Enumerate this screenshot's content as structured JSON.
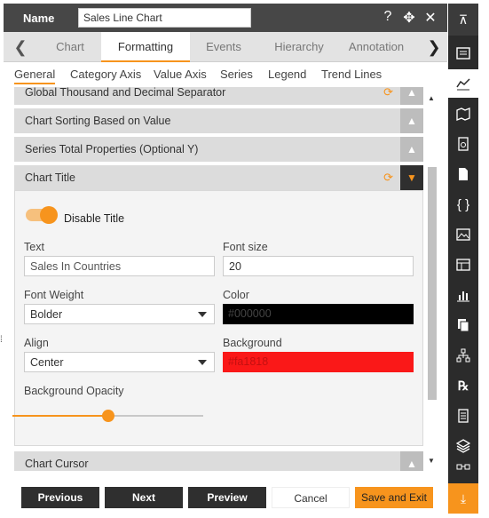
{
  "header": {
    "name_label": "Name",
    "name_value": "Sales Line Chart",
    "icons": [
      "help-icon",
      "move-icon",
      "close-icon"
    ]
  },
  "tabs": {
    "items": [
      "Chart",
      "Formatting",
      "Events",
      "Hierarchy",
      "Annotation"
    ],
    "active": "Formatting"
  },
  "subtabs": {
    "items": [
      "General",
      "Category Axis",
      "Value Axis",
      "Series",
      "Legend",
      "Trend Lines"
    ],
    "active": "General"
  },
  "sections": {
    "thousand": "Global Thousand and Decimal Separator",
    "sorting": "Chart Sorting Based on Value",
    "series_total": "Series Total Properties (Optional Y)",
    "chart_title": "Chart Title",
    "chart_cursor": "Chart Cursor"
  },
  "chart_title_panel": {
    "toggle_label": "Disable Title",
    "toggle_on": true,
    "text_label": "Text",
    "text_value": "Sales In Countries",
    "font_size_label": "Font size",
    "font_size_value": "20",
    "font_weight_label": "Font Weight",
    "font_weight_value": "Bolder",
    "color_label": "Color",
    "color_value": "#000000",
    "align_label": "Align",
    "align_value": "Center",
    "background_label": "Background",
    "background_value": "#fa1818",
    "opacity_label": "Background Opacity",
    "opacity_level": 0.5
  },
  "colors": {
    "accent": "#f7941d",
    "header_bg": "#474747",
    "section_bg": "#dcdcdc",
    "rail_bg": "#2b2b2b",
    "color_swatch": "#000000",
    "background_swatch": "#fa1818"
  },
  "footer": {
    "previous": "Previous",
    "next": "Next",
    "preview": "Preview",
    "cancel": "Cancel",
    "save_exit": "Save and Exit"
  },
  "rail": {
    "icons": [
      "collapse-up-icon",
      "chart-list-icon",
      "line-chart-icon",
      "map-icon",
      "document-settings-icon",
      "document-icon",
      "code-braces-icon",
      "image-icon",
      "table-icon",
      "bar-chart-icon",
      "copy-icon",
      "hierarchy-icon",
      "rx-icon",
      "report-icon",
      "layers-icon",
      "flow-icon",
      "download-icon"
    ],
    "active": "line-chart-icon"
  }
}
